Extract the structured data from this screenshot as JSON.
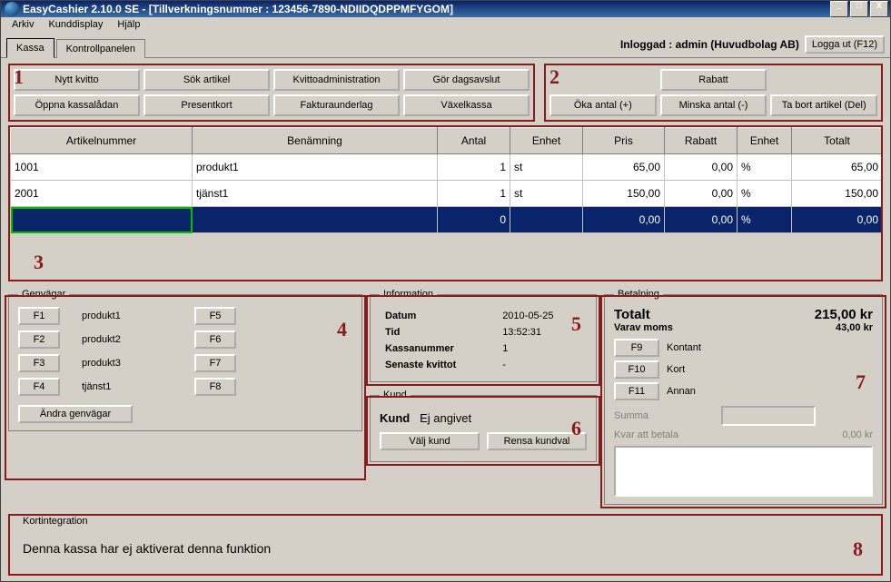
{
  "window": {
    "title": "EasyCashier 2.10.0 SE - [Tillverkningsnummer : 123456-7890-NDIIDQDPPMFYGOM]",
    "controls": {
      "min": "_",
      "max": "□",
      "close": "X"
    }
  },
  "menubar": {
    "items": [
      "Arkiv",
      "Kunddisplay",
      "Hjälp"
    ]
  },
  "tabs": {
    "items": [
      "Kassa",
      "Kontrollpanelen"
    ],
    "active": "Kassa"
  },
  "login": {
    "text": "Inloggad : admin (Huvudbolag AB)",
    "logout": "Logga ut (F12)"
  },
  "sections": {
    "s1": "1",
    "s2": "2",
    "s3": "3",
    "s4": "4",
    "s5": "5",
    "s6": "6",
    "s7": "7",
    "s8": "8"
  },
  "btns_left": {
    "b1": "Nytt kvitto",
    "b2": "Sök artikel",
    "b3": "Kvittoadministration",
    "b4": "Gör dagsavslut",
    "b5": "Öppna kassalådan",
    "b6": "Presentkort",
    "b7": "Fakturaunderlag",
    "b8": "Växelkassa"
  },
  "btns_right": {
    "b1": "Rabatt",
    "b2": "Öka antal (+)",
    "b3": "Minska antal (-)",
    "b4": "Ta bort artikel (Del)"
  },
  "grid": {
    "headers": {
      "art": "Artikelnummer",
      "ben": "Benämning",
      "ant": "Antal",
      "enh": "Enhet",
      "pris": "Pris",
      "rab": "Rabatt",
      "enh2": "Enhet",
      "tot": "Totalt"
    },
    "rows": [
      {
        "art": "1001",
        "ben": "produkt1",
        "ant": "1",
        "enh": "st",
        "pris": "65,00",
        "rab": "0,00",
        "enh2": "%",
        "tot": "65,00"
      },
      {
        "art": "2001",
        "ben": "tjänst1",
        "ant": "1",
        "enh": "st",
        "pris": "150,00",
        "rab": "0,00",
        "enh2": "%",
        "tot": "150,00"
      }
    ],
    "sel": {
      "art": "",
      "ben": "",
      "ant": "0",
      "enh": "",
      "pris": "0,00",
      "rab": "0,00",
      "enh2": "%",
      "tot": "0,00"
    }
  },
  "shortcuts": {
    "legend": "Genvägar",
    "keys": {
      "f1": "F1",
      "f2": "F2",
      "f3": "F3",
      "f4": "F4",
      "f5": "F5",
      "f6": "F6",
      "f7": "F7",
      "f8": "F8"
    },
    "labels": {
      "f1": "produkt1",
      "f2": "produkt2",
      "f3": "produkt3",
      "f4": "tjänst1"
    },
    "edit": "Ändra genvägar"
  },
  "info": {
    "legend": "Information",
    "rows": {
      "date_label": "Datum",
      "date_val": "2010-05-25",
      "time_label": "Tid",
      "time_val": "13:52:31",
      "reg_label": "Kassanummer",
      "reg_val": "1",
      "last_label": "Senaste kvittot",
      "last_val": "-"
    }
  },
  "kund": {
    "legend": "Kund",
    "label": "Kund",
    "value": "Ej angivet",
    "choose": "Välj kund",
    "clear": "Rensa kundval"
  },
  "pay": {
    "legend": "Betalning",
    "total_label": "Totalt",
    "total_val": "215,00 kr",
    "moms_label": "Varav moms",
    "moms_val": "43,00 kr",
    "f9": "F9",
    "f9_label": "Kontant",
    "f10": "F10",
    "f10_label": "Kort",
    "f11": "F11",
    "f11_label": "Annan",
    "summa_label": "Summa",
    "kvar_label": "Kvar att betala",
    "kvar_val": "0,00 kr"
  },
  "card": {
    "legend": "Kortintegration",
    "text": "Denna kassa har ej aktiverat denna funktion"
  }
}
